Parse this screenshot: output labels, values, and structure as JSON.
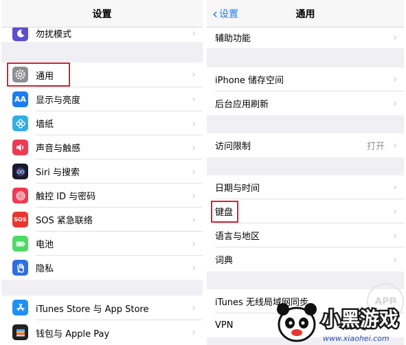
{
  "left_screen": {
    "title": "设置",
    "rows": [
      {
        "label": "勿扰模式",
        "icon": "moon-icon"
      },
      {
        "label": "通用",
        "icon": "gear-icon"
      },
      {
        "label": "显示与亮度",
        "icon": "text-size-icon",
        "icon_text": "AA"
      },
      {
        "label": "墙纸",
        "icon": "flower-icon"
      },
      {
        "label": "声音与触感",
        "icon": "speaker-icon"
      },
      {
        "label": "Siri 与搜索",
        "icon": "siri-icon"
      },
      {
        "label": "触控 ID 与密码",
        "icon": "fingerprint-icon"
      },
      {
        "label": "SOS 紧急联络",
        "icon": "sos-icon",
        "icon_text": "SOS"
      },
      {
        "label": "电池",
        "icon": "battery-icon"
      },
      {
        "label": "隐私",
        "icon": "hand-icon"
      },
      {
        "label": "iTunes Store 与 App Store",
        "icon": "app-store-icon"
      },
      {
        "label": "钱包与 Apple Pay",
        "icon": "wallet-icon"
      }
    ]
  },
  "right_screen": {
    "back_label": "设置",
    "title": "通用",
    "rows": [
      {
        "label": "辅助功能"
      },
      {
        "label": "iPhone 储存空间"
      },
      {
        "label": "后台应用刷新"
      },
      {
        "label": "访问限制",
        "value": "打开"
      },
      {
        "label": "日期与时间"
      },
      {
        "label": "键盘"
      },
      {
        "label": "语言与地区"
      },
      {
        "label": "词典"
      },
      {
        "label": "iTunes 无线局域网同步"
      },
      {
        "label": "VPN"
      }
    ]
  },
  "watermark": {
    "badge_text": "APP",
    "logo_text": "小黑游戏",
    "url": "www.xiaohei.com"
  },
  "colors": {
    "highlight": "#d9222a",
    "ios_blue": "#1e7cf2",
    "group_background": "#efeff4"
  }
}
